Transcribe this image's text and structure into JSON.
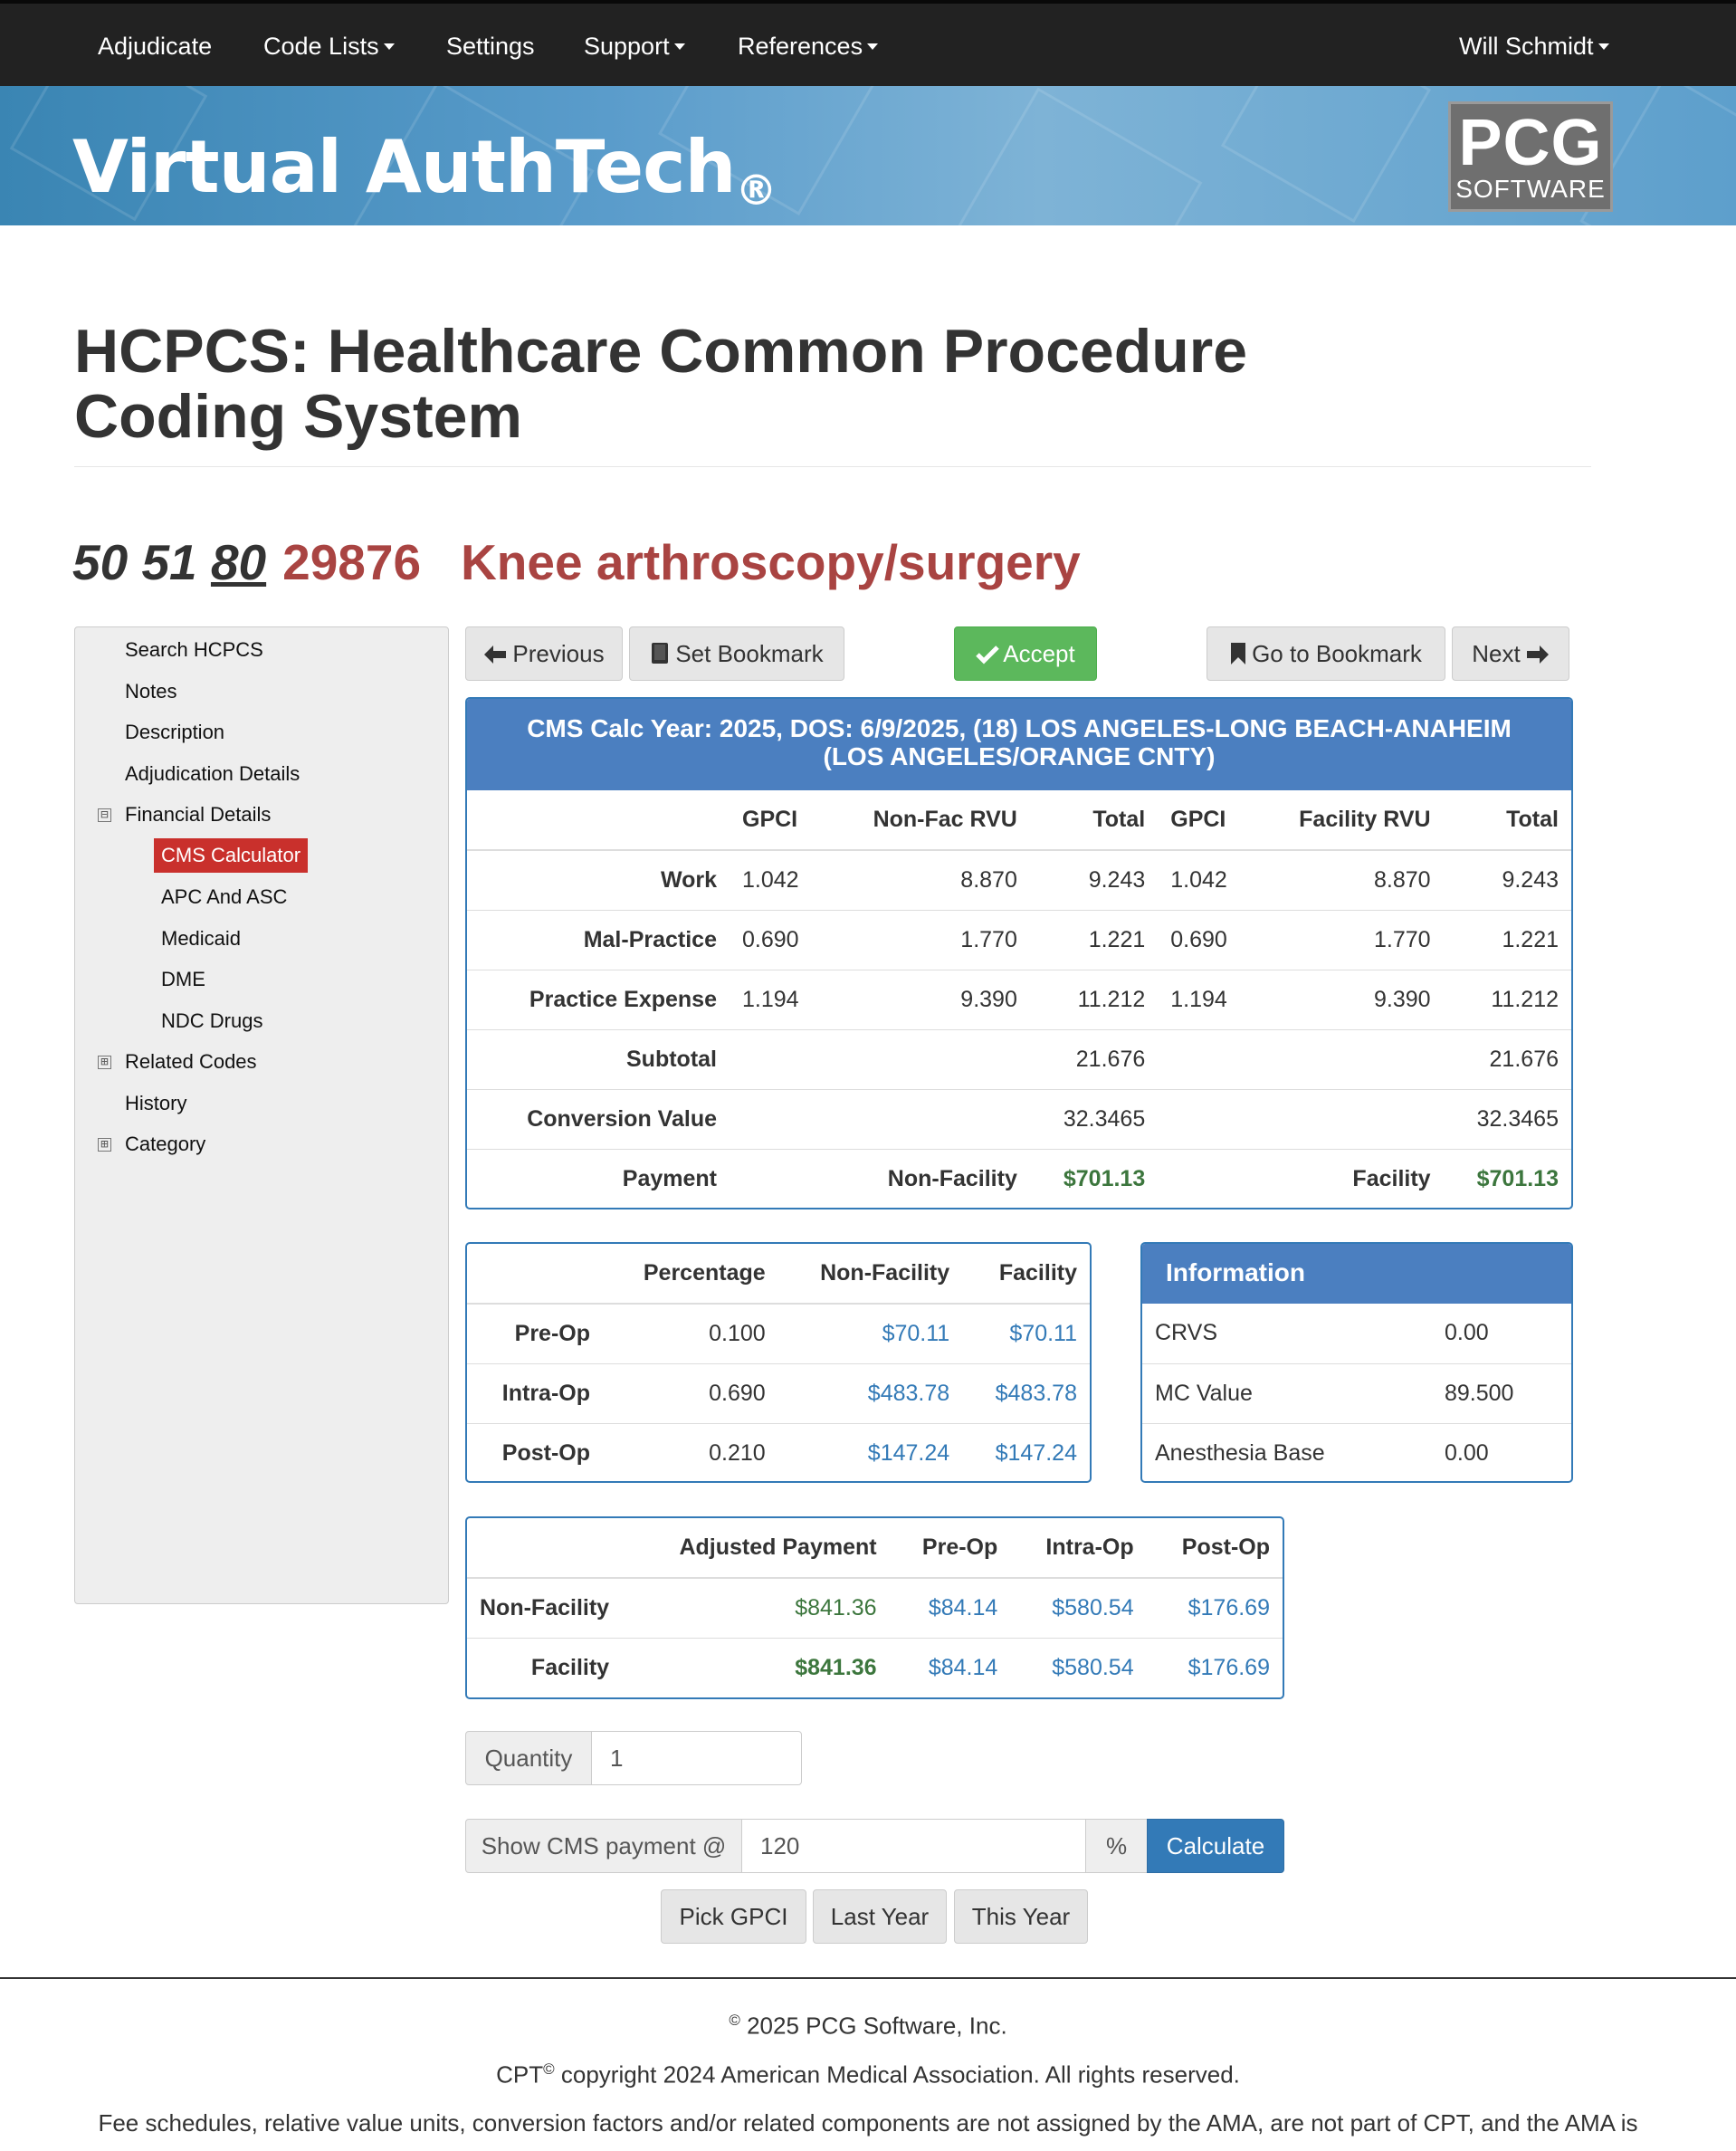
{
  "nav": {
    "adjudicate": "Adjudicate",
    "code_lists": "Code Lists",
    "settings": "Settings",
    "support": "Support",
    "references": "References",
    "user": "Will Schmidt"
  },
  "banner": {
    "title": "Virtual AuthTech",
    "reg_mark": "®",
    "logo_big": "PCG",
    "logo_small": "SOFTWARE"
  },
  "page": {
    "title": "HCPCS: Healthcare Common Procedure Coding System",
    "mod_50": "50",
    "mod_51": "51",
    "mod_80": "80",
    "code": "29876",
    "description": "Knee arthroscopy/surgery"
  },
  "sidebar": {
    "search": "Search HCPCS",
    "notes": "Notes",
    "description": "Description",
    "adjudication": "Adjudication Details",
    "financial": "Financial Details",
    "cms_calculator": "CMS Calculator",
    "apc": "APC And ASC",
    "medicaid": "Medicaid",
    "dme": "DME",
    "ndc": "NDC Drugs",
    "related": "Related Codes",
    "history": "History",
    "category": "Category",
    "expanded_symbol": "⊟",
    "collapsed_symbol": "⊞"
  },
  "buttons": {
    "previous": "Previous",
    "bookmark": "Set Bookmark",
    "accept": "Accept",
    "goto_bookmark": "Go to Bookmark",
    "next": "Next"
  },
  "cms": {
    "header": "CMS Calc Year: 2025, DOS: 6/9/2025, (18) LOS ANGELES-LONG BEACH-ANAHEIM (LOS ANGELES/ORANGE CNTY)",
    "columns": [
      "GPCI",
      "Non-Fac RVU",
      "Total",
      "GPCI",
      "Facility RVU",
      "Total"
    ],
    "rows": [
      {
        "label": "Work",
        "nf_gpci": "1.042",
        "nf_rvu": "8.870",
        "nf_total": "9.243",
        "f_gpci": "1.042",
        "f_rvu": "8.870",
        "f_total": "9.243"
      },
      {
        "label": "Mal-Practice",
        "nf_gpci": "0.690",
        "nf_rvu": "1.770",
        "nf_total": "1.221",
        "f_gpci": "0.690",
        "f_rvu": "1.770",
        "f_total": "1.221"
      },
      {
        "label": "Practice Expense",
        "nf_gpci": "1.194",
        "nf_rvu": "9.390",
        "nf_total": "11.212",
        "f_gpci": "1.194",
        "f_rvu": "9.390",
        "f_total": "11.212"
      }
    ],
    "subtotal_label": "Subtotal",
    "subtotal_nf": "21.676",
    "subtotal_f": "21.676",
    "conversion_label": "Conversion Value",
    "conversion_nf": "32.3465",
    "conversion_f": "32.3465",
    "payment_label": "Payment",
    "payment_nf_label": "Non-Facility",
    "payment_nf": "$701.13",
    "payment_f_label": "Facility",
    "payment_f": "$701.13"
  },
  "periop": {
    "columns": [
      "Percentage",
      "Non-Facility",
      "Facility"
    ],
    "rows": [
      {
        "label": "Pre-Op",
        "pct": "0.100",
        "nf": "$70.11",
        "f": "$70.11"
      },
      {
        "label": "Intra-Op",
        "pct": "0.690",
        "nf": "$483.78",
        "f": "$483.78"
      },
      {
        "label": "Post-Op",
        "pct": "0.210",
        "nf": "$147.24",
        "f": "$147.24"
      }
    ]
  },
  "info": {
    "header": "Information",
    "rows": [
      {
        "label": "CRVS",
        "value": "0.00"
      },
      {
        "label": "MC Value",
        "value": "89.500"
      },
      {
        "label": "Anesthesia Base",
        "value": "0.00"
      }
    ]
  },
  "adjusted": {
    "columns": [
      "Adjusted Payment",
      "Pre-Op",
      "Intra-Op",
      "Post-Op"
    ],
    "rows": [
      {
        "label": "Non-Facility",
        "adj": "$841.36",
        "pre": "$84.14",
        "intra": "$580.54",
        "post": "$176.69"
      },
      {
        "label": "Facility",
        "adj": "$841.36",
        "pre": "$84.14",
        "intra": "$580.54",
        "post": "$176.69"
      }
    ]
  },
  "form": {
    "quantity_label": "Quantity",
    "quantity_value": "1",
    "show_cms_label": "Show CMS payment @",
    "show_cms_value": "120",
    "percent_symbol": "%",
    "calculate": "Calculate",
    "pick_gpci": "Pick GPCI",
    "last_year": "Last Year",
    "this_year": "This Year"
  },
  "footer": {
    "copyright_symbol": "©",
    "copyright": "2025 PCG Software, Inc.",
    "cpt": "CPT",
    "cpt_copyright": "copyright 2024 American Medical Association. All rights reserved.",
    "fee_notice": "Fee schedules, relative value units, conversion factors and/or related components are not assigned by the AMA, are not part of CPT, and the AMA is"
  },
  "colors": {
    "navbar": "#222222",
    "banner": "#5a9ccb",
    "accent_red": "#a94442",
    "active_item": "#c9302c",
    "panel_blue": "#337ab7",
    "success_green": "#5cb85c",
    "payment_green": "#3c763d"
  }
}
